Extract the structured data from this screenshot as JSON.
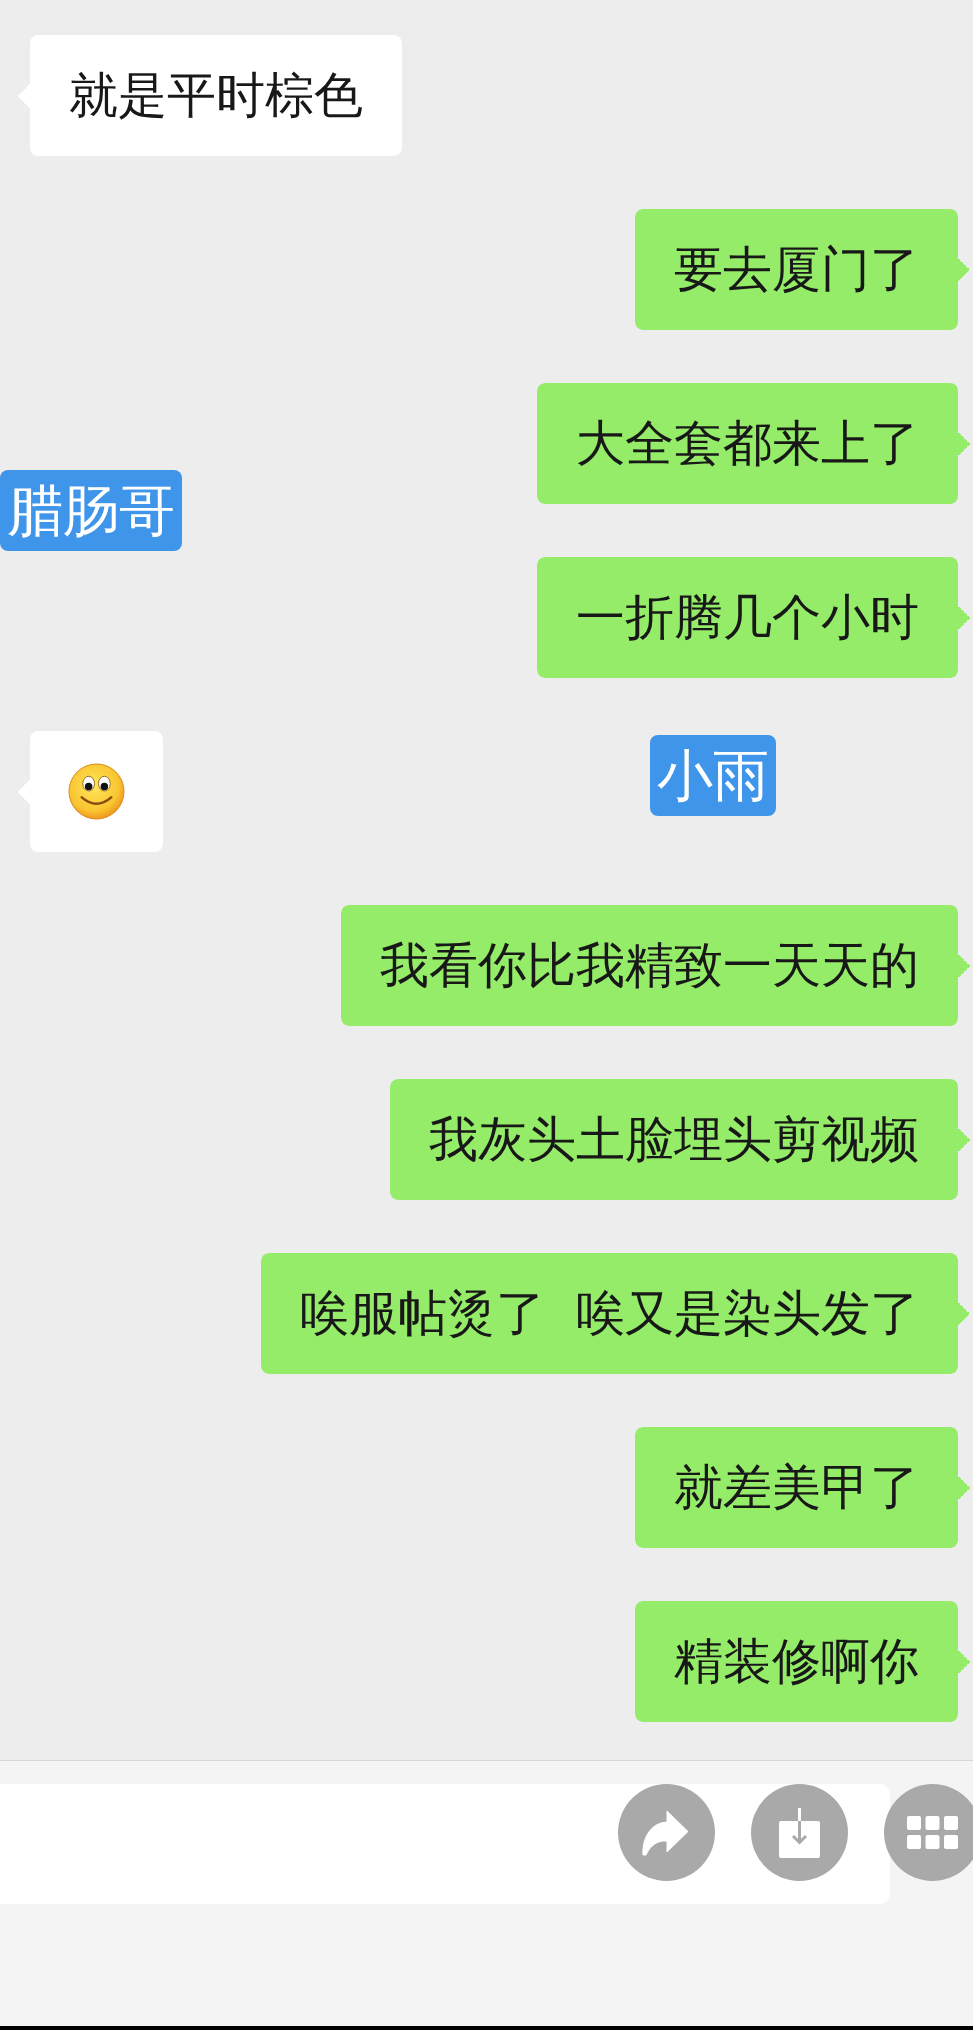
{
  "messages": [
    {
      "outgoing": false,
      "kind": "text",
      "text": "就是平时棕色"
    },
    {
      "outgoing": true,
      "kind": "text",
      "text": "要去厦门了"
    },
    {
      "outgoing": true,
      "kind": "text",
      "text": "大全套都来上了"
    },
    {
      "outgoing": true,
      "kind": "text",
      "text": "一折腾几个小时"
    },
    {
      "outgoing": false,
      "kind": "emoji"
    },
    {
      "outgoing": true,
      "kind": "text",
      "text": "我看你比我精致一天天的"
    },
    {
      "outgoing": true,
      "kind": "text",
      "text": "我灰头土脸埋头剪视频"
    },
    {
      "outgoing": true,
      "kind": "text",
      "text": "唉服帖烫了  唉又是染头发了"
    },
    {
      "outgoing": true,
      "kind": "text",
      "text": "就差美甲了"
    },
    {
      "outgoing": true,
      "kind": "text",
      "text": "精装修啊你"
    }
  ],
  "name_tags": [
    {
      "text": "腊肠哥"
    },
    {
      "text": "小雨"
    }
  ]
}
